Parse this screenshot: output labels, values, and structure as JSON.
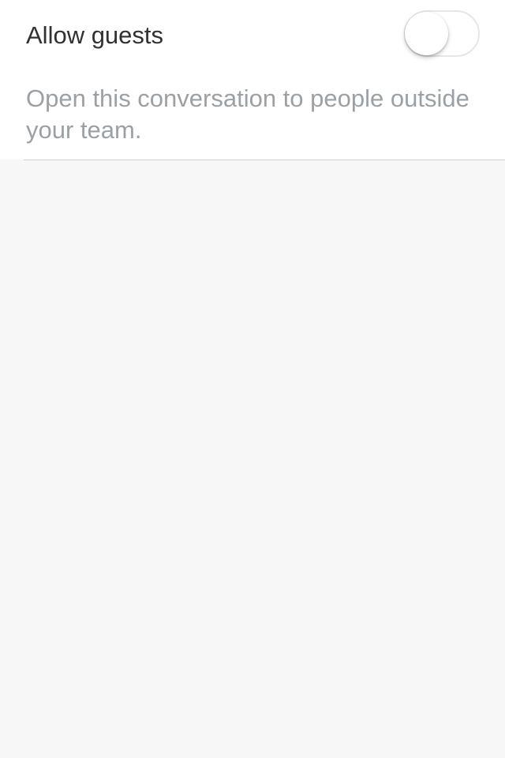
{
  "setting": {
    "title": "Allow guests",
    "description": "Open this conversation to people outside your team.",
    "enabled": false
  },
  "colors": {
    "background": "#f7f7f7",
    "card": "#ffffff",
    "title_text": "#2f3135",
    "description_text": "#9aa1a6",
    "toggle_border": "#e6e6e8"
  }
}
